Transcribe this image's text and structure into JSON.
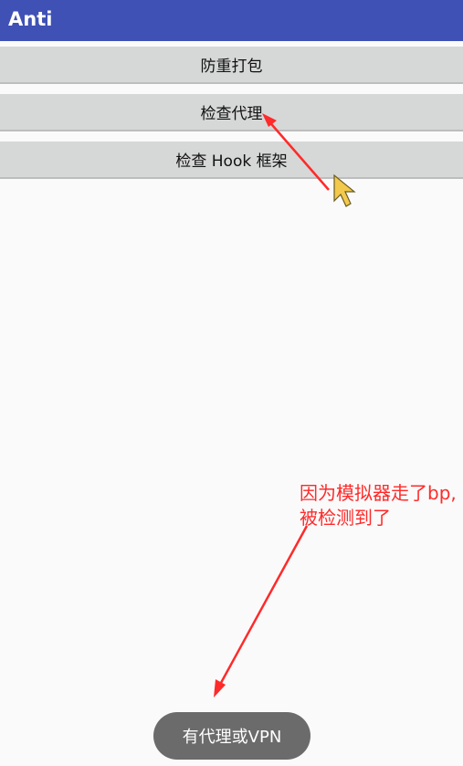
{
  "app": {
    "title": "Anti"
  },
  "buttons": [
    {
      "label": "防重打包"
    },
    {
      "label": "检查代理"
    },
    {
      "label": "检查 Hook 框架"
    }
  ],
  "annotation": {
    "line1": "因为模拟器走了bp,",
    "line2": "被检测到了"
  },
  "toast": {
    "text": "有代理或VPN"
  },
  "colors": {
    "appbar": "#3f51b5",
    "annotation": "#ff2a2a"
  }
}
